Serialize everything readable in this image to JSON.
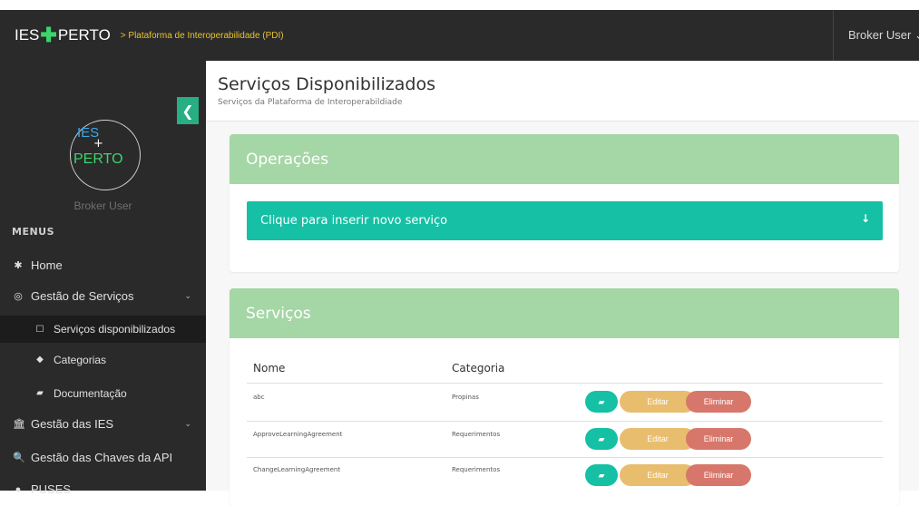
{
  "header": {
    "brand_ies": "IES",
    "brand_plus": "✚",
    "brand_perto": "PERTO",
    "subtitle": "> Plataforma de Interoperabilidade (PDI)",
    "user_menu": "Broker User ⌄"
  },
  "sidebar": {
    "toggle_icon": "❮",
    "logo_ies": "IES",
    "logo_plus": "+",
    "logo_perto": "PERTO",
    "user_name": "Broker User",
    "menus_label": "MENUS",
    "items": [
      {
        "icon": "✱",
        "label": "Home"
      },
      {
        "icon": "◎",
        "label": "Gestão de Serviços",
        "chevron": "⌄"
      },
      {
        "icon": "🏛",
        "label": "Gestão das IES",
        "chevron": "⌄"
      },
      {
        "icon": "🔍",
        "label": "Gestão das Chaves da API"
      },
      {
        "icon": "●",
        "label": "PUSES"
      }
    ],
    "subitems": [
      {
        "icon": "☐",
        "label": "Serviços disponibilizados"
      },
      {
        "icon": "◆",
        "label": "Categorias"
      },
      {
        "icon": "▰",
        "label": "Documentação"
      }
    ]
  },
  "page": {
    "title": "Serviços Disponibilizados",
    "subtitle": "Serviços da Plataforma de Interoperabildiade"
  },
  "operacoes": {
    "title": "Operações",
    "collapse_label": "Clique para inserir novo serviço",
    "collapse_icon": "↓"
  },
  "servicos": {
    "title": "Serviços",
    "columns": [
      "Nome",
      "Categoria"
    ],
    "rows": [
      {
        "nome": "abc",
        "categoria": "Propinas"
      },
      {
        "nome": "ApproveLearningAgreement",
        "categoria": "Requerimentos"
      },
      {
        "nome": "ChangeLearningAgreement",
        "categoria": "Requerimentos"
      }
    ],
    "doc_icon": "▰",
    "edit_label": "Editar",
    "delete_label": "Eliminar"
  },
  "colors": {
    "header_bg": "#2a2a2a",
    "accent_green": "#3cd46c",
    "panel_head": "#a5d6a5",
    "teal": "#15c0a5",
    "edit": "#e8bd6e",
    "delete": "#d7776b"
  }
}
